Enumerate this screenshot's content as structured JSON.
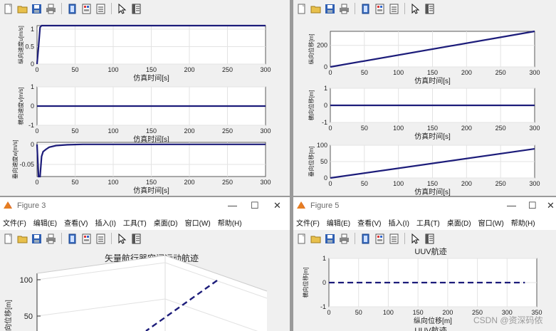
{
  "toolbar_icons": [
    "new-figure-icon",
    "open-icon",
    "save-icon",
    "print-icon",
    "edit-plot-icon",
    "insert-colorbar-icon",
    "insert-legend-icon",
    "pointer-icon",
    "property-inspector-icon"
  ],
  "tl": {
    "p1": {
      "ylabel": "纵向速度u[m/s]",
      "xlabel": "仿真时间[s]",
      "xticks": [
        "0",
        "50",
        "100",
        "150",
        "200",
        "250",
        "300"
      ],
      "yticks": [
        "1",
        "0.5",
        "0"
      ]
    },
    "p2": {
      "ylabel": "横向速度v[m/s]",
      "xlabel": "仿真时间[s]",
      "xticks": [
        "0",
        "50",
        "100",
        "150",
        "200",
        "250",
        "300"
      ],
      "yticks": [
        "1",
        "0",
        "-1"
      ]
    },
    "p3": {
      "ylabel": "垂向速度w[m/s]",
      "xlabel": "仿真时间[s]",
      "xticks": [
        "0",
        "50",
        "100",
        "150",
        "200",
        "250",
        "300"
      ],
      "yticks": [
        "0",
        "-0.05"
      ]
    }
  },
  "tr": {
    "p1": {
      "ylabel": "纵向位移[m]",
      "xlabel": "仿真时间[s]",
      "xticks": [
        "0",
        "50",
        "100",
        "150",
        "200",
        "250",
        "300"
      ],
      "yticks": [
        "200",
        "0"
      ]
    },
    "p2": {
      "ylabel": "横向位移[m]",
      "xlabel": "仿真时间[s]",
      "xticks": [
        "0",
        "50",
        "100",
        "150",
        "200",
        "250",
        "300"
      ],
      "yticks": [
        "1",
        "0",
        "-1"
      ]
    },
    "p3": {
      "ylabel": "垂向位移[m]",
      "xlabel": "仿真时间[s]",
      "xticks": [
        "0",
        "50",
        "100",
        "150",
        "200",
        "250",
        "300"
      ],
      "yticks": [
        "100",
        "50",
        "0"
      ]
    }
  },
  "fig3": {
    "title": "Figure 3",
    "menu": [
      "文件(F)",
      "编辑(E)",
      "查看(V)",
      "插入(I)",
      "工具(T)",
      "桌面(D)",
      "窗口(W)",
      "帮助(H)"
    ],
    "plot_title": "矢量航行器空间运动航迹",
    "zlabel": "向位移[m]",
    "zticks": [
      "100",
      "50"
    ]
  },
  "fig5": {
    "title": "Figure 5",
    "menu": [
      "文件(F)",
      "编辑(E)",
      "查看(V)",
      "插入(I)",
      "工具(T)",
      "桌面(D)",
      "窗口(W)",
      "帮助(H)"
    ],
    "plot_title": "UUV航迹",
    "ylabel": "横向位移[m]",
    "xlabel": "纵向位移[m]",
    "xticks": [
      "0",
      "50",
      "100",
      "150",
      "200",
      "250",
      "300",
      "350"
    ],
    "yticks": [
      "1",
      "0",
      "-1"
    ],
    "next_title": "UUV航迹"
  },
  "watermark": "CSDN @资深码侬",
  "chart_data": [
    {
      "type": "line",
      "xlabel": "仿真时间[s]",
      "ylabel": "纵向速度u[m/s]",
      "xlim": [
        0,
        300
      ],
      "ylim": [
        0,
        1.1
      ],
      "x": [
        0,
        2,
        4,
        6,
        300
      ],
      "y": [
        0,
        0.5,
        1.05,
        1.1,
        1.1
      ]
    },
    {
      "type": "line",
      "xlabel": "仿真时间[s]",
      "ylabel": "横向速度v[m/s]",
      "xlim": [
        0,
        300
      ],
      "ylim": [
        -1,
        1
      ],
      "x": [
        0,
        300
      ],
      "y": [
        0,
        0
      ]
    },
    {
      "type": "line",
      "xlabel": "仿真时间[s]",
      "ylabel": "垂向速度w[m/s]",
      "xlim": [
        0,
        300
      ],
      "ylim": [
        -0.08,
        0.005
      ],
      "x": [
        0,
        2,
        4,
        6,
        8,
        12,
        16,
        25,
        40,
        60,
        300
      ],
      "y": [
        0,
        -0.08,
        -0.08,
        -0.03,
        -0.018,
        -0.012,
        -0.007,
        -0.003,
        -0.001,
        0,
        0
      ]
    },
    {
      "type": "line",
      "xlabel": "仿真时间[s]",
      "ylabel": "纵向位移[m]",
      "xlim": [
        0,
        300
      ],
      "ylim": [
        0,
        330
      ],
      "x": [
        0,
        300
      ],
      "y": [
        0,
        330
      ]
    },
    {
      "type": "line",
      "xlabel": "仿真时间[s]",
      "ylabel": "横向位移[m]",
      "xlim": [
        0,
        300
      ],
      "ylim": [
        -1,
        1
      ],
      "x": [
        0,
        300
      ],
      "y": [
        0,
        0
      ]
    },
    {
      "type": "line",
      "xlabel": "仿真时间[s]",
      "ylabel": "垂向位移[m]",
      "xlim": [
        0,
        300
      ],
      "ylim": [
        0,
        100
      ],
      "x": [
        0,
        300
      ],
      "y": [
        0,
        89
      ]
    },
    {
      "type": "line",
      "title": "UUV航迹",
      "xlabel": "纵向位移[m]",
      "ylabel": "横向位移[m]",
      "xlim": [
        0,
        350
      ],
      "ylim": [
        -1,
        1
      ],
      "x": [
        0,
        330
      ],
      "y": [
        0,
        0
      ],
      "dashed": true
    }
  ]
}
